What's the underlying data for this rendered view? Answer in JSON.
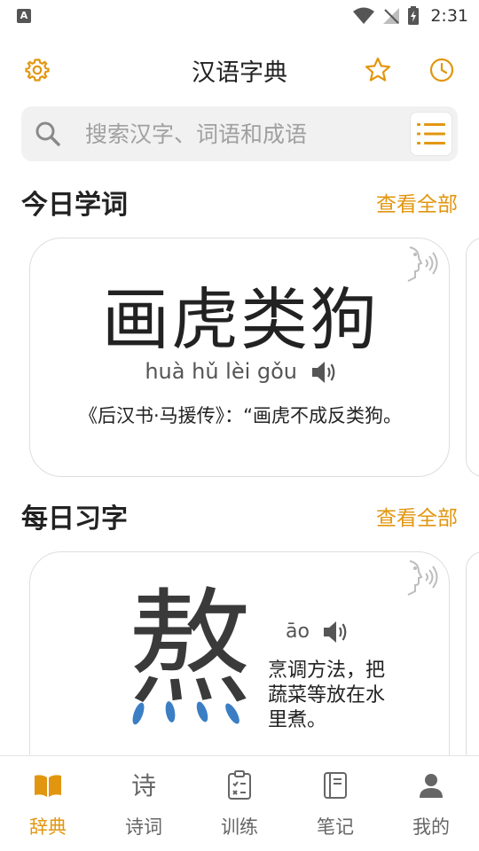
{
  "status_bar": {
    "left_badge": "A",
    "time": "2:31"
  },
  "app_bar": {
    "title": "汉语字典"
  },
  "search": {
    "placeholder": "搜索汉字、词语和成语"
  },
  "daily_word": {
    "title": "今日学词",
    "see_all": "查看全部",
    "word": "画虎类狗",
    "pinyin": "huà hǔ lèi gǒu",
    "source": "《后汉书·马援传》：“画虎不成反类狗。"
  },
  "daily_char": {
    "title": "每日习字",
    "see_all": "查看全部",
    "character": "熬",
    "pinyin": "āo",
    "definition": "烹调方法，把蔬菜等放在水里煮。"
  },
  "bottom_nav": {
    "items": [
      {
        "label": "辞典",
        "icon": "open-book-icon",
        "active": true
      },
      {
        "label": "诗词",
        "icon": "poem-icon",
        "active": false
      },
      {
        "label": "训练",
        "icon": "checklist-icon",
        "active": false
      },
      {
        "label": "笔记",
        "icon": "notebook-icon",
        "active": false
      },
      {
        "label": "我的",
        "icon": "person-icon",
        "active": false
      }
    ]
  },
  "colors": {
    "accent": "#e2960f",
    "stroke_highlight": "#3b7ec4",
    "text": "#222222"
  }
}
